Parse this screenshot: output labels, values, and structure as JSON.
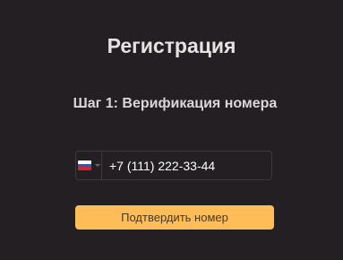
{
  "page": {
    "title": "Регистрация",
    "step_title": "Шаг 1: Верификация номера"
  },
  "phone": {
    "country": "RU",
    "country_flag_icon": "russia-flag-icon",
    "value": "+7 (111) 222-33-44"
  },
  "actions": {
    "confirm_label": "Подтвердить номер"
  },
  "colors": {
    "background": "#231f22",
    "accent": "#ffbd58",
    "border": "#3c383b"
  }
}
